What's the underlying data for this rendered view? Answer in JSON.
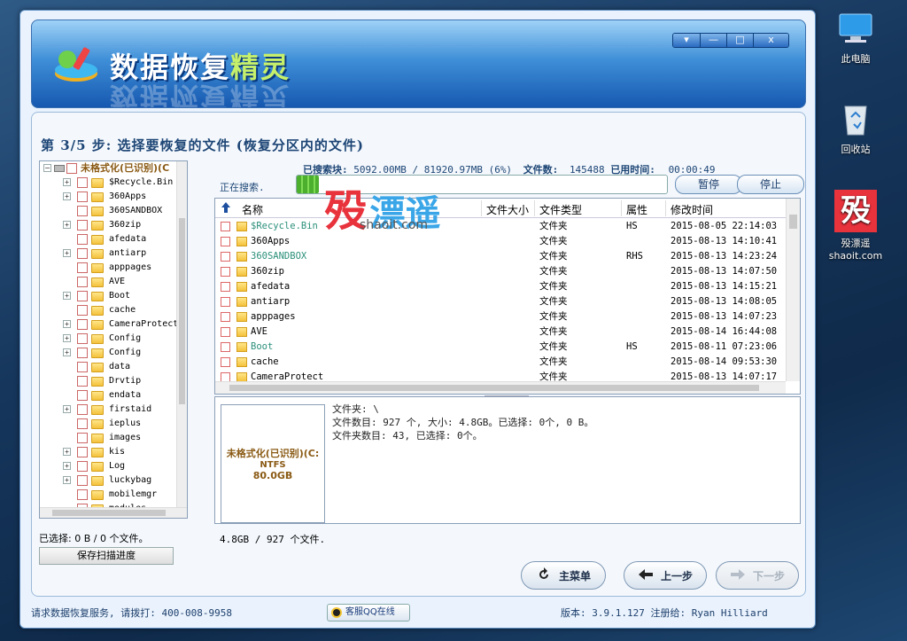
{
  "desktop": {
    "icons": [
      {
        "label": "此电脑"
      },
      {
        "label": "回收站"
      },
      {
        "label": "殁漂遥"
      },
      {
        "label": "shaoit.com"
      }
    ]
  },
  "window": {
    "app_title_a": "数据恢复",
    "app_title_b": "精灵",
    "controls": [
      "▾",
      "—",
      "□",
      "x"
    ]
  },
  "step": {
    "title": "第 3/5 步: 选择要恢复的文件 (恢复分区内的文件)"
  },
  "tree": {
    "root": "未格式化(已识别)(C",
    "items": [
      {
        "label": "$Recycle.Bin",
        "exp": true
      },
      {
        "label": "360Apps",
        "exp": true
      },
      {
        "label": "360SANDBOX",
        "exp": false
      },
      {
        "label": "360zip",
        "exp": true
      },
      {
        "label": "afedata",
        "exp": false
      },
      {
        "label": "antiarp",
        "exp": true
      },
      {
        "label": "apppages",
        "exp": false
      },
      {
        "label": "AVE",
        "exp": false
      },
      {
        "label": "Boot",
        "exp": true
      },
      {
        "label": "cache",
        "exp": false
      },
      {
        "label": "CameraProtect",
        "exp": true
      },
      {
        "label": "Config",
        "exp": true
      },
      {
        "label": "Config",
        "exp": true
      },
      {
        "label": "data",
        "exp": false
      },
      {
        "label": "Drvtip",
        "exp": false
      },
      {
        "label": "endata",
        "exp": false
      },
      {
        "label": "firstaid",
        "exp": true
      },
      {
        "label": "ieplus",
        "exp": false
      },
      {
        "label": "images",
        "exp": false
      },
      {
        "label": "kis",
        "exp": true
      },
      {
        "label": "Log",
        "exp": true
      },
      {
        "label": "luckybag",
        "exp": true
      },
      {
        "label": "mobilemgr",
        "exp": false
      },
      {
        "label": "modules",
        "exp": false
      }
    ]
  },
  "scan": {
    "blocks_label": "已搜索块:",
    "blocks_value": "5092.00MB / 81920.97MB (6%)",
    "files_label": "文件数:",
    "files_value": "145488",
    "time_label": "已用时间:",
    "time_value": "00:00:49",
    "searching_label": "正在搜索.",
    "progress_pct": 6,
    "pause_label": "暂停",
    "stop_label": "停止"
  },
  "file_list": {
    "headers": {
      "name": "名称",
      "size": "文件大小",
      "type": "文件类型",
      "attr": "属性",
      "modified": "修改时间"
    },
    "rows": [
      {
        "name": "$Recycle.Bin",
        "type": "文件夹",
        "attr": "HS",
        "modified": "2015-08-05 22:14:03",
        "color": "#2a8f7a"
      },
      {
        "name": "360Apps",
        "type": "文件夹",
        "attr": "",
        "modified": "2015-08-13 14:10:41",
        "color": "#000000"
      },
      {
        "name": "360SANDBOX",
        "type": "文件夹",
        "attr": "RHS",
        "modified": "2015-08-13 14:23:24",
        "color": "#2a8f7a"
      },
      {
        "name": "360zip",
        "type": "文件夹",
        "attr": "",
        "modified": "2015-08-13 14:07:50",
        "color": "#000000"
      },
      {
        "name": "afedata",
        "type": "文件夹",
        "attr": "",
        "modified": "2015-08-13 14:15:21",
        "color": "#000000"
      },
      {
        "name": "antiarp",
        "type": "文件夹",
        "attr": "",
        "modified": "2015-08-13 14:08:05",
        "color": "#000000"
      },
      {
        "name": "apppages",
        "type": "文件夹",
        "attr": "",
        "modified": "2015-08-13 14:07:23",
        "color": "#000000"
      },
      {
        "name": "AVE",
        "type": "文件夹",
        "attr": "",
        "modified": "2015-08-14 16:44:08",
        "color": "#000000"
      },
      {
        "name": "Boot",
        "type": "文件夹",
        "attr": "HS",
        "modified": "2015-08-11 07:23:06",
        "color": "#2a8f7a"
      },
      {
        "name": "cache",
        "type": "文件夹",
        "attr": "",
        "modified": "2015-08-14 09:53:30",
        "color": "#000000"
      },
      {
        "name": "CameraProtect",
        "type": "文件夹",
        "attr": "",
        "modified": "2015-08-13 14:07:17",
        "color": "#000000"
      }
    ]
  },
  "info": {
    "disk_name": "未格式化(已识别)(C:",
    "disk_fs": "NTFS",
    "disk_size": "80.0GB",
    "line1": "文件夹: \\",
    "line2": "文件数目: 927 个, 大小: 4.8GB。已选择: 0个, 0 B。",
    "line3": "文件夹数目: 43, 已选择: 0个。"
  },
  "status": {
    "selected": "已选择: 0 B / 0 个文件。",
    "total": "4.8GB / 927 个文件.",
    "save_label": "保存扫描进度"
  },
  "nav": {
    "main_menu": "主菜单",
    "prev": "上一步",
    "next": "下一步"
  },
  "footer": {
    "service": "请求数据恢复服务, 请拨打: 400-008-9958",
    "qq": "客服QQ在线",
    "version": "版本: 3.9.1.127 注册给: Ryan Hilliard"
  },
  "watermark": {
    "char": "殁",
    "text": "漂遥",
    "url": "shaoit.com"
  },
  "colors": {
    "accent": "#1d4575",
    "brand_green": "#c6f06b",
    "watermark_red": "#e8323c"
  }
}
